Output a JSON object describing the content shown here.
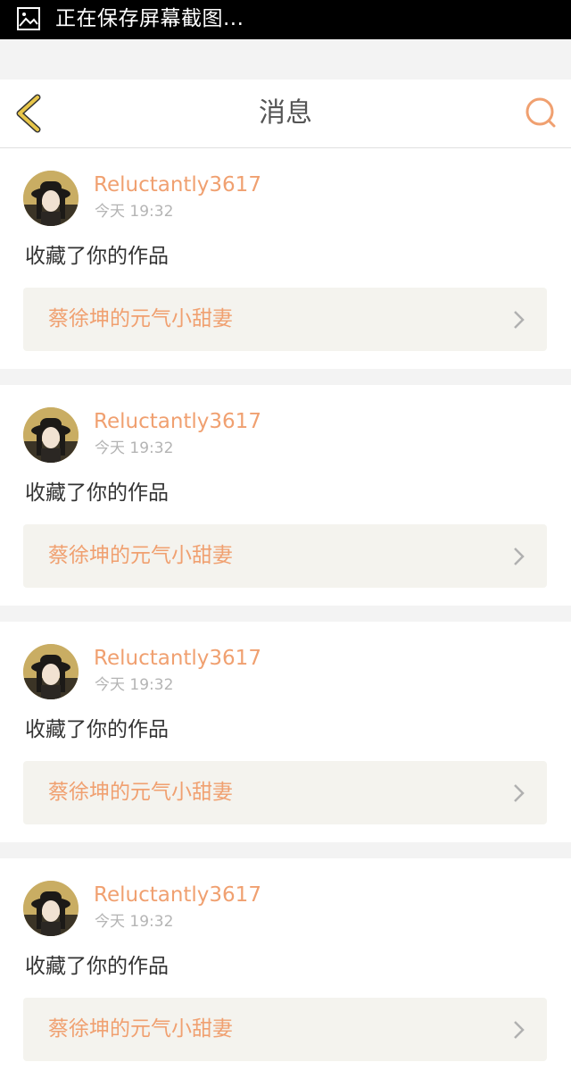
{
  "status_bar": {
    "text": "正在保存屏幕截图...",
    "icon": "image-icon"
  },
  "header": {
    "title": "消息",
    "back_icon": "chevron-left-icon",
    "search_icon": "search-icon"
  },
  "colors": {
    "accent": "#f0a070",
    "back_icon": "#e8c64a",
    "page_background": "#f3f3f3",
    "card_link_background": "#f4f3ee"
  },
  "messages": [
    {
      "username": "Reluctantly3617",
      "time": "今天 19:32",
      "action": "收藏了你的作品",
      "work_title": "蔡徐坤的元气小甜妻"
    },
    {
      "username": "Reluctantly3617",
      "time": "今天 19:32",
      "action": "收藏了你的作品",
      "work_title": "蔡徐坤的元气小甜妻"
    },
    {
      "username": "Reluctantly3617",
      "time": "今天 19:32",
      "action": "收藏了你的作品",
      "work_title": "蔡徐坤的元气小甜妻"
    },
    {
      "username": "Reluctantly3617",
      "time": "今天 19:32",
      "action": "收藏了你的作品",
      "work_title": "蔡徐坤的元气小甜妻"
    }
  ]
}
